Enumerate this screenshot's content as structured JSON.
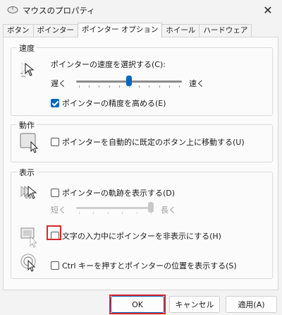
{
  "window": {
    "title": "マウスのプロパティ",
    "close_glyph": "✕"
  },
  "tabs": [
    {
      "label": "ボタン",
      "active": false
    },
    {
      "label": "ポインター",
      "active": false
    },
    {
      "label": "ポインター オプション",
      "active": true
    },
    {
      "label": "ホイール",
      "active": false
    },
    {
      "label": "ハードウェア",
      "active": false
    }
  ],
  "speed": {
    "group_label": "速度",
    "prompt": "ポインターの速度を選択する(C):",
    "slow_label": "遅く",
    "fast_label": "速く",
    "value_fraction": 0.5,
    "enhance_precision_label": "ポインターの精度を高める(E)",
    "enhance_precision_checked": true
  },
  "snap": {
    "group_label": "動作",
    "snap_to_label": "ポインターを自動的に既定のボタン上に移動する(U)",
    "snap_to_checked": false
  },
  "visibility": {
    "group_label": "表示",
    "trails_label": "ポインターの軌跡を表示する(D)",
    "trails_checked": false,
    "short_label": "短く",
    "long_label": "長く",
    "trails_value_fraction": 1.0,
    "hide_typing_label": "文字の入力中にポインターを非表示にする(H)",
    "hide_typing_checked": false,
    "ctrl_locate_label": "Ctrl キーを押すとポインターの位置を表示する(S)",
    "ctrl_locate_checked": false
  },
  "buttons": {
    "ok": "OK",
    "cancel": "キャンセル",
    "apply": "適用(A)"
  },
  "colors": {
    "accent": "#0067c0",
    "highlight_red": "#d9262c"
  }
}
